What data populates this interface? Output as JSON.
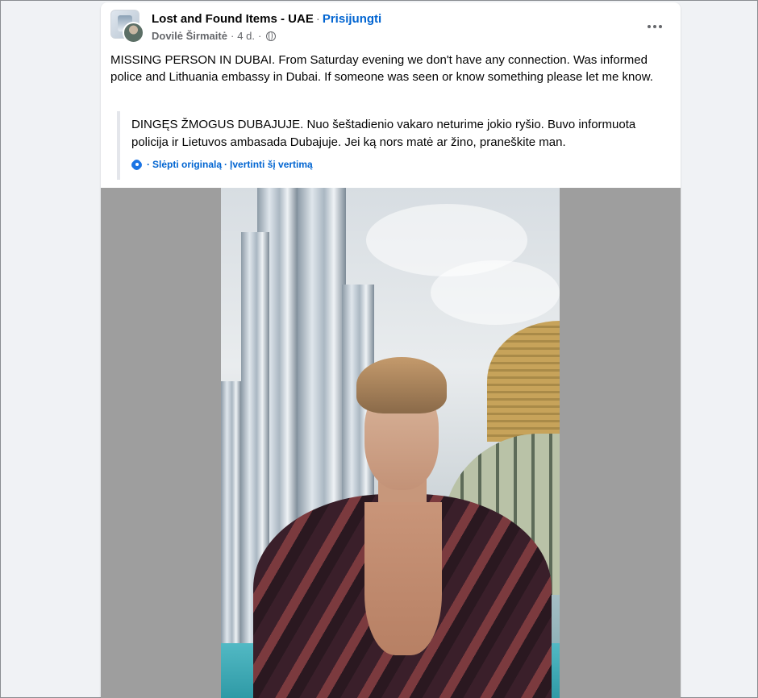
{
  "post": {
    "group_name": "Lost and Found Items - UAE",
    "separator": "·",
    "join_label": "Prisijungti",
    "author": "Dovilė Širmaitė",
    "time": "4 d.",
    "audience_icon": "globe-icon",
    "menu_icon": "more-icon",
    "text": "MISSING PERSON IN DUBAI. From Saturday evening we don't have any connection. Was informed police and Lithuania embassy in Dubai. If someone was seen or know something please let me know.",
    "original_text": "DINGĘS ŽMOGUS DUBAJUJE. Nuo šeštadienio vakaro neturime jokio ryšio. Buvo informuota policija ir Lietuvos ambasada Dubajuje. Jei ką nors matė ar žino, praneškite man.",
    "hide_original_label": "Slėpti originalą",
    "rate_translation_label": "Įvertinti šį vertimą",
    "translation_icon": "gear-icon"
  },
  "colors": {
    "link": "#0064d1",
    "text": "#050505",
    "secondary": "#65676b",
    "background": "#f0f2f5"
  }
}
